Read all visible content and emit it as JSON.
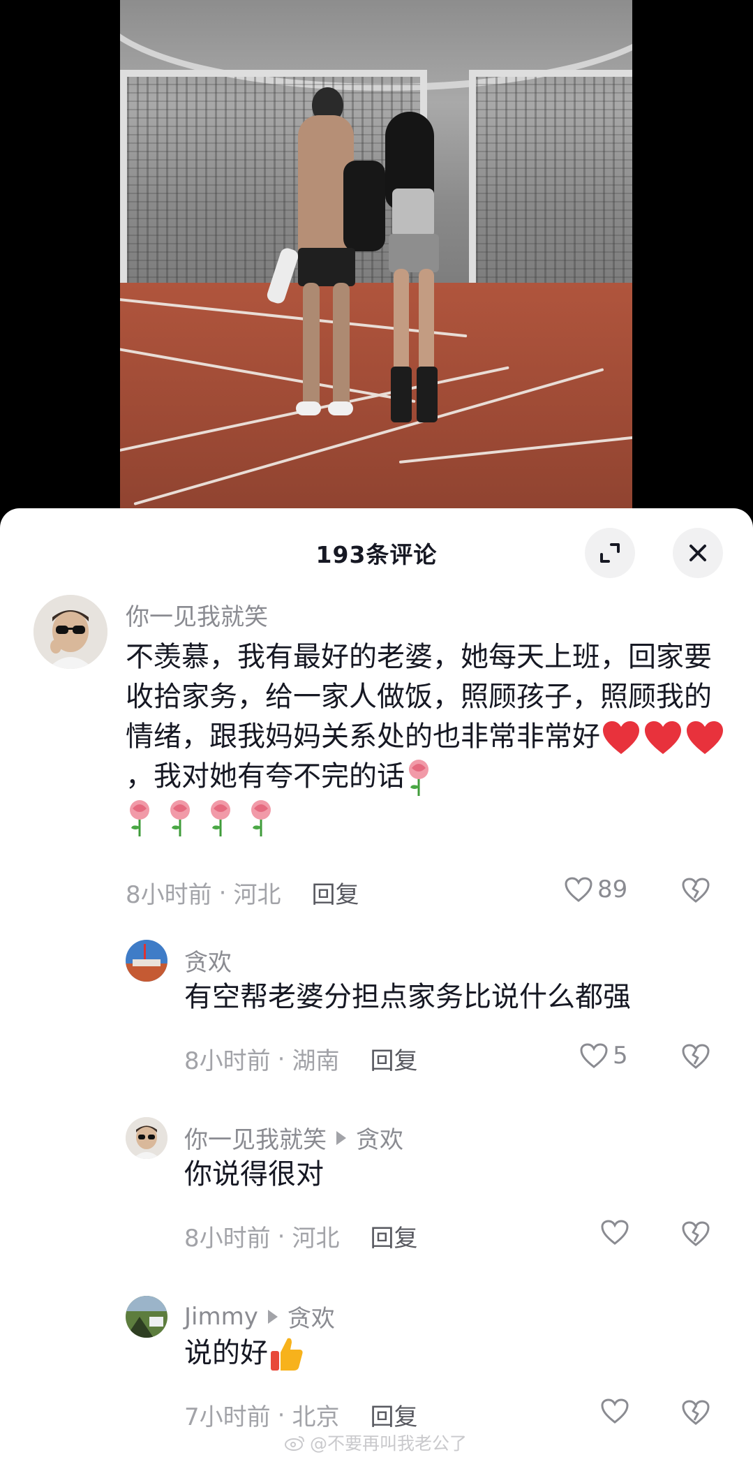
{
  "sheet": {
    "title": "193条评论",
    "expand_icon": "expand-icon",
    "close_icon": "close-icon"
  },
  "comments": [
    {
      "username": "你一见我就笑",
      "text_parts": [
        "不羡慕，我有最好的老婆，她每天上班，回家要收拾家务，给一家人做饭，照顾孩子，照顾我的情绪，跟我妈妈关系处的也非常非常好",
        "，我对她有夸不完的话"
      ],
      "emoji": [
        "heart",
        "heart",
        "heart",
        "rose",
        "rose",
        "rose",
        "rose",
        "rose"
      ],
      "time": "8小时前",
      "location": "河北",
      "reply_label": "回复",
      "likes": "89"
    }
  ],
  "replies": [
    {
      "username": "贪欢",
      "reply_to": "",
      "text": "有空帮老婆分担点家务比说什么都强",
      "time": "8小时前",
      "location": "湖南",
      "reply_label": "回复",
      "likes": "5"
    },
    {
      "username": "你一见我就笑",
      "reply_to": "贪欢",
      "text": "你说得很对",
      "time": "8小时前",
      "location": "河北",
      "reply_label": "回复",
      "likes": ""
    },
    {
      "username": "Jimmy",
      "reply_to": "贪欢",
      "text": "说的好",
      "time": "7小时前",
      "location": "北京",
      "reply_label": "回复",
      "likes": ""
    }
  ],
  "meta_separator": "·",
  "watermark": "@不要再叫我老公了",
  "colors": {
    "text_primary": "#161823",
    "text_secondary": "#8a8b91",
    "heart_red": "#e8323c"
  }
}
